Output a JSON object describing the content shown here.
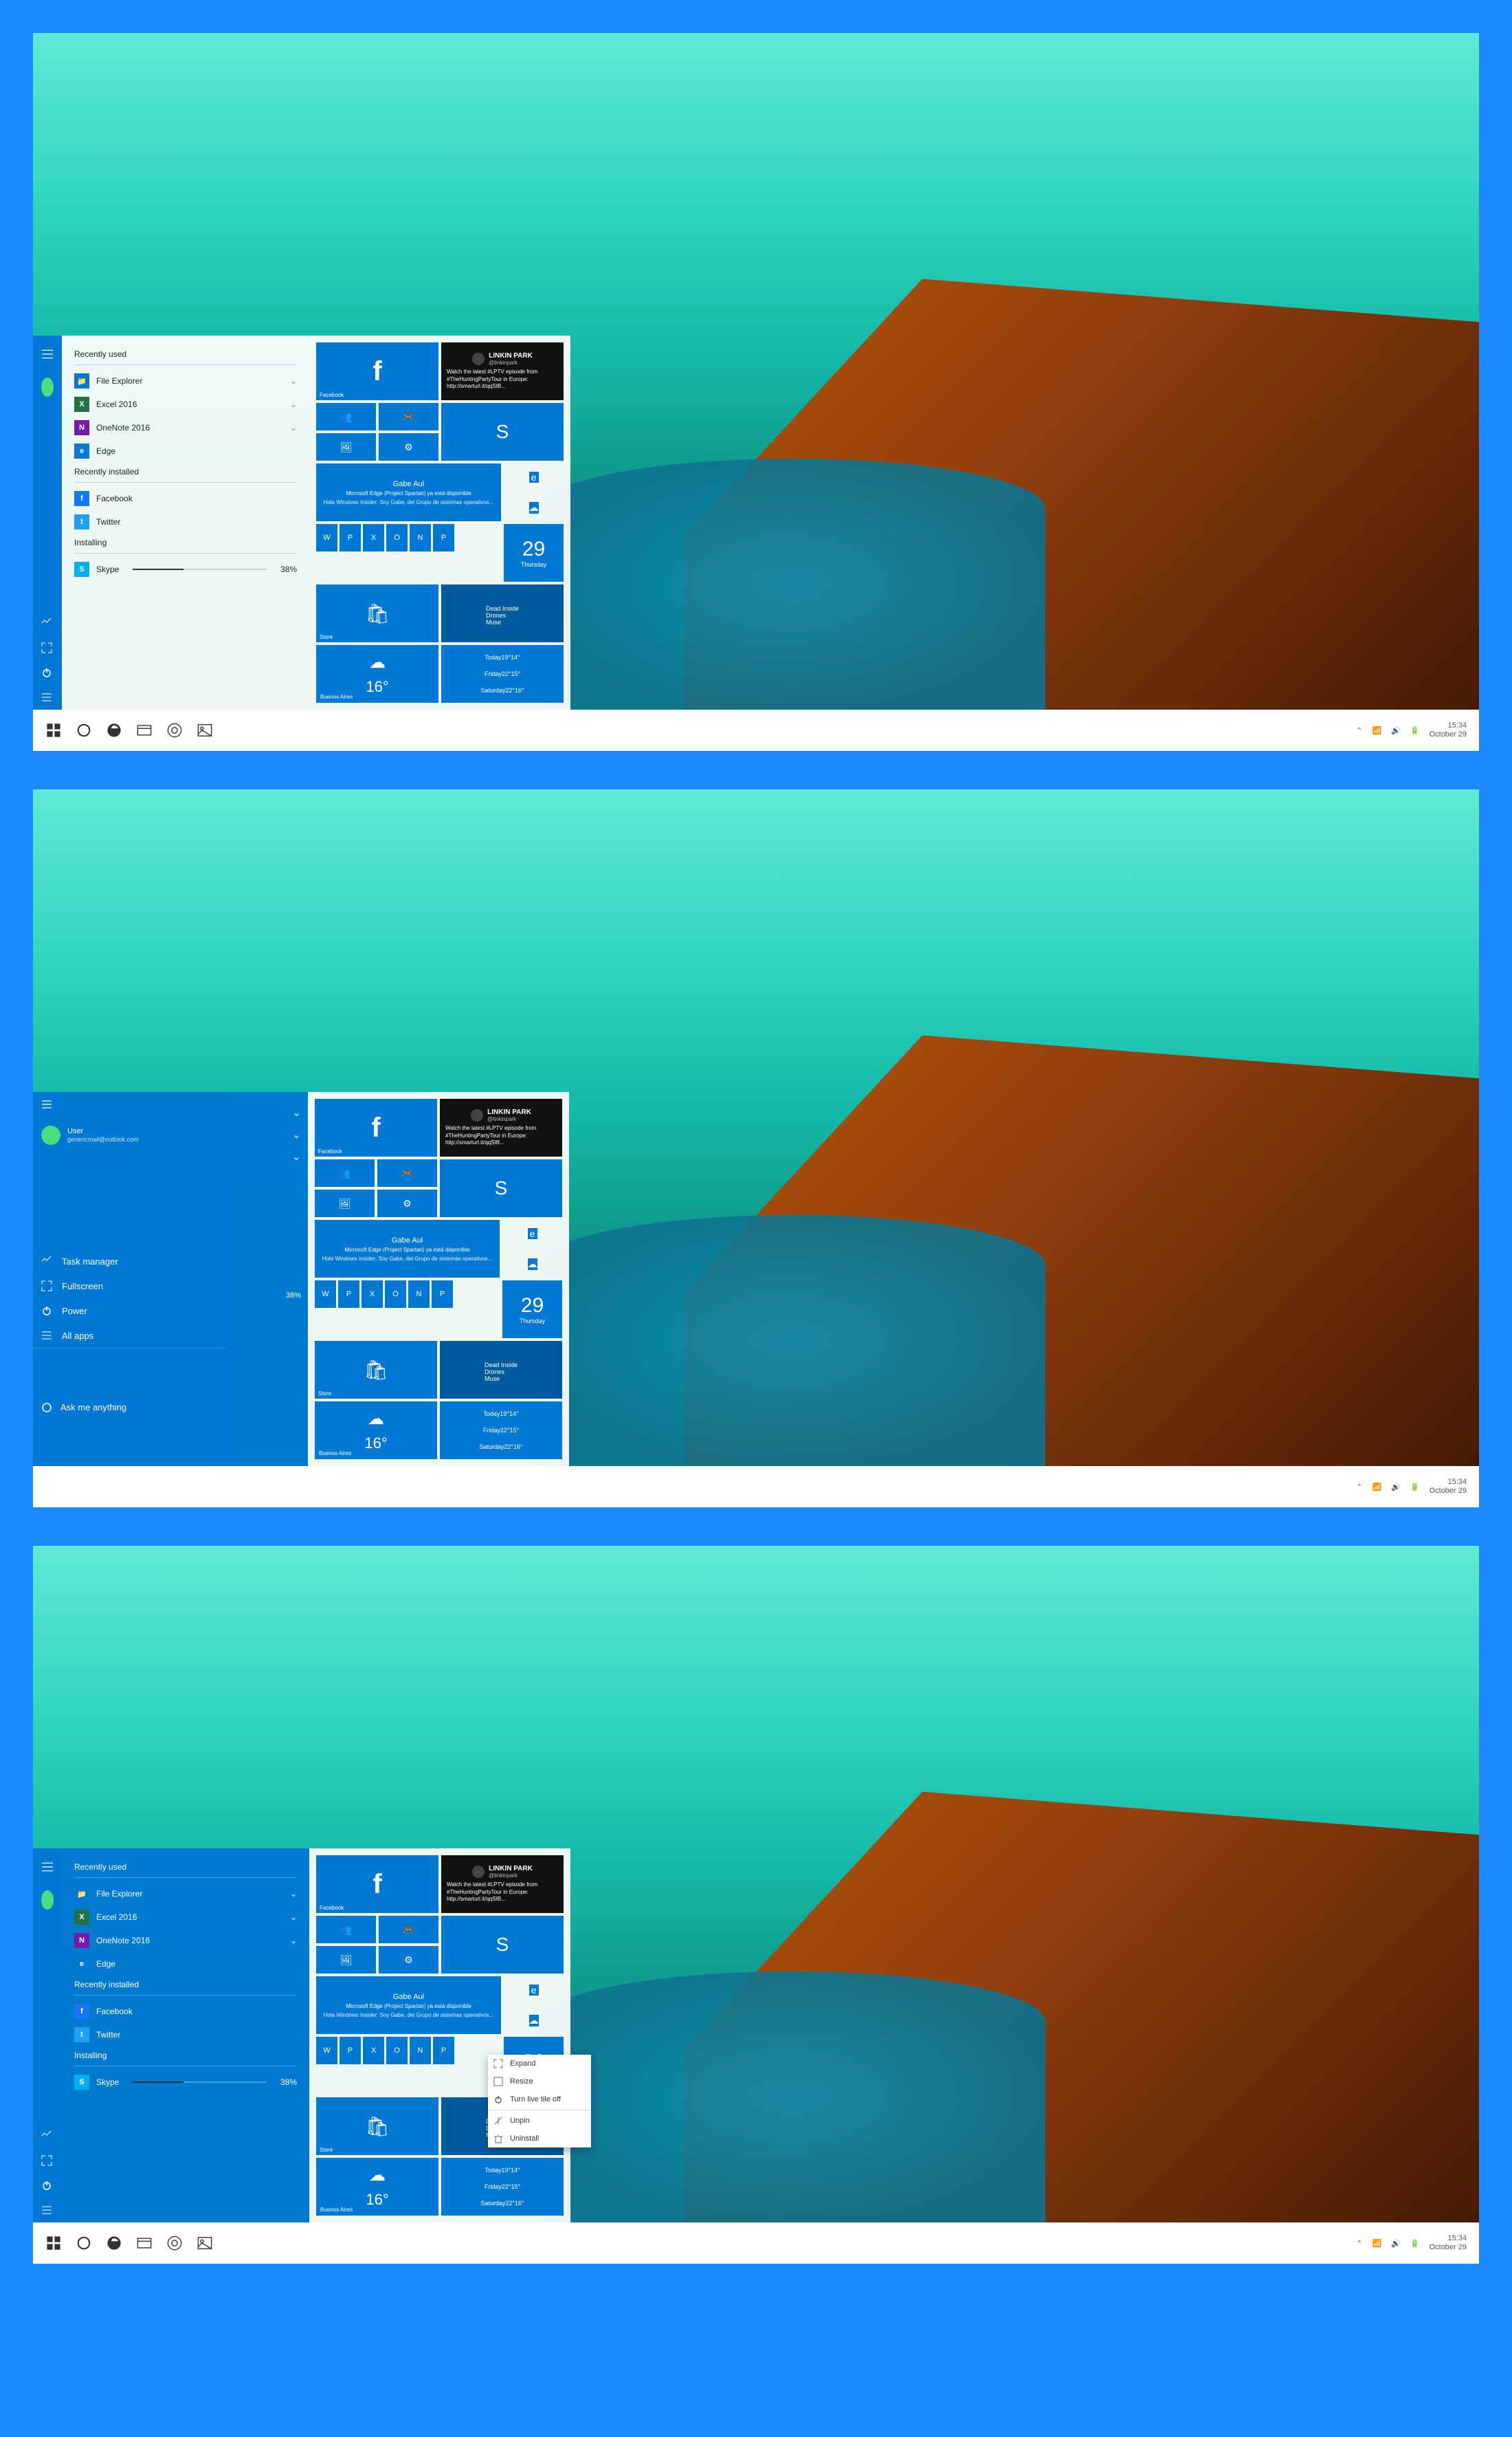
{
  "taskbar": {
    "time": "15:34",
    "date": "October 29"
  },
  "sections": {
    "recent": "Recently used",
    "installed": "Recently installed",
    "installing": "Installing"
  },
  "apps": {
    "file_explorer": "File Explorer",
    "excel": "Excel 2016",
    "onenote": "OneNote 2016",
    "edge": "Edge",
    "facebook": "Facebook",
    "twitter": "Twitter",
    "skype": "Skype",
    "skype_progress": "38%"
  },
  "user": {
    "name": "User",
    "email": "genericmail@outlook.com"
  },
  "sidebar_actions": {
    "task_manager": "Task manager",
    "fullscreen": "Fullscreen",
    "power": "Power",
    "all_apps": "All apps"
  },
  "search_placeholder": "Ask me anything",
  "tiles": {
    "facebook": "Facebook",
    "social": {
      "name": "LINKIN PARK",
      "handle": "@linkinpark",
      "body": "Watch the latest #LPTV episode from #TheHuntingPartyTour in Europe: http://smarturl.it/qqSIB..."
    },
    "gabe": {
      "name": "Gabe Aul",
      "sub": "Microsoft Edge (Project Spartan) ya está disponible",
      "body": "Hola Windows Insider: Soy Gabe, del Grupo de sistemas operativos..."
    },
    "date": {
      "num": "29",
      "day": "Thursday"
    },
    "music": {
      "title": "Dead Inside",
      "album": "Drones",
      "artist": "Muse"
    },
    "store": "Store",
    "weather": {
      "temp": "16°",
      "city": "Buenos Aires"
    },
    "forecast": [
      {
        "day": "Today",
        "hi": "19°",
        "lo": "14°"
      },
      {
        "day": "Friday",
        "hi": "22°",
        "lo": "15°"
      },
      {
        "day": "Saturday",
        "hi": "22°",
        "lo": "16°"
      }
    ]
  },
  "context_menu": {
    "expand": "Expand",
    "resize": "Resize",
    "turn_off": "Turn live tile off",
    "unpin": "Unpin",
    "uninstall": "Uninstall"
  },
  "progress_visible": "38%"
}
